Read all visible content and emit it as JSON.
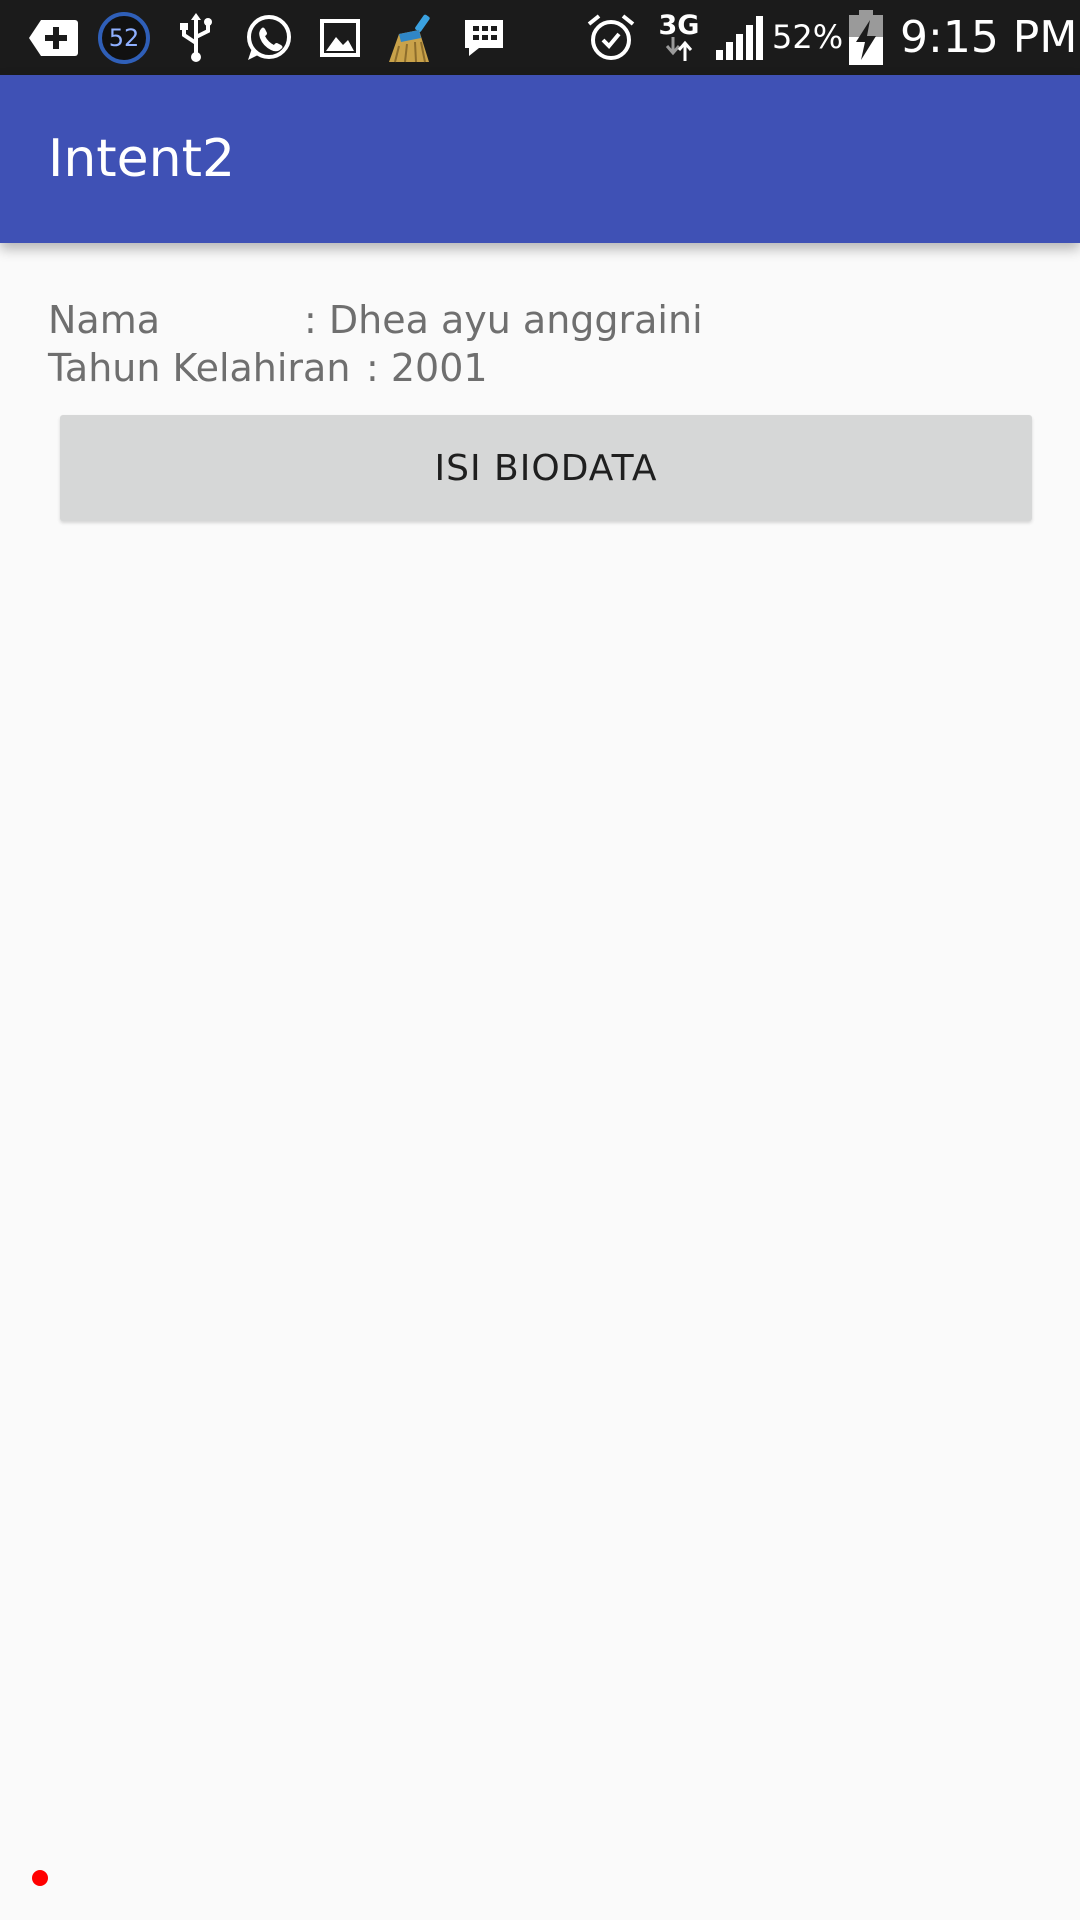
{
  "status_bar": {
    "notification_count": "52",
    "network_type": "3G",
    "battery_percent": "52%",
    "time": "9:15 PM",
    "icons": [
      "add-box-icon",
      "notification-count-badge",
      "usb-icon",
      "whatsapp-icon",
      "gallery-icon",
      "cleaner-broom-icon",
      "bbm-chat-icon",
      "alarm-icon",
      "data-arrows-icon",
      "signal-icon",
      "battery-charging-icon"
    ]
  },
  "app_bar": {
    "title": "Intent2",
    "color": "#3f51b5"
  },
  "biodata": {
    "name_label": "Nama",
    "name_value": ": Dhea ayu anggraini",
    "year_label": "Tahun Kelahiran",
    "year_value": ": 2001"
  },
  "button": {
    "label": "ISI BIODATA",
    "color": "#d6d7d7"
  },
  "indicator": {
    "color": "#ff0000"
  }
}
